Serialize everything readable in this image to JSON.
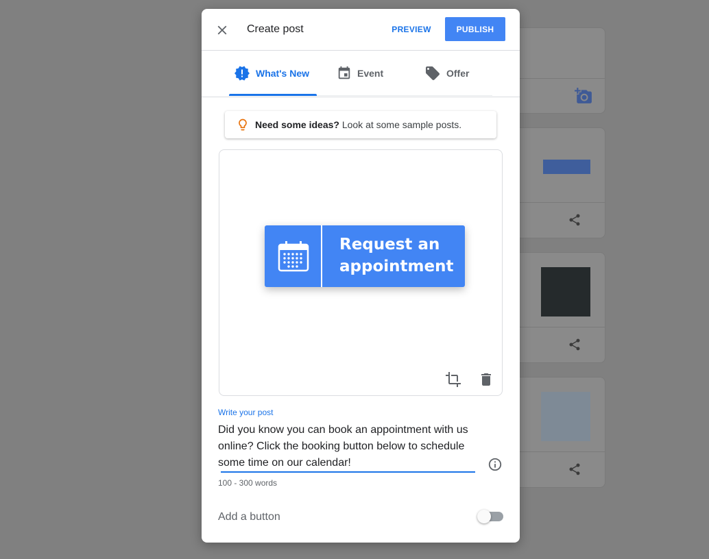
{
  "dialog": {
    "title": "Create post",
    "preview_label": "PREVIEW",
    "publish_label": "PUBLISH"
  },
  "tabs": [
    {
      "label": "What's New",
      "icon": "alert-badge-icon",
      "active": true
    },
    {
      "label": "Event",
      "icon": "calendar-icon",
      "active": false
    },
    {
      "label": "Offer",
      "icon": "tag-icon",
      "active": false
    }
  ],
  "ideas": {
    "bold": "Need some ideas?",
    "text": " Look at some sample posts."
  },
  "image": {
    "button_text": "Request an appointment"
  },
  "post": {
    "label": "Write your post",
    "value": "Did you know you can book an appointment with us online? Click the booking button below to schedule some time on our calendar!",
    "hint": "100 - 300 words"
  },
  "add_button": {
    "label": "Add a button",
    "enabled": false
  },
  "colors": {
    "accent": "#1a73e8",
    "publish_bg": "#4285f4",
    "lightbulb": "#e8710a",
    "overlay": "#808080"
  }
}
